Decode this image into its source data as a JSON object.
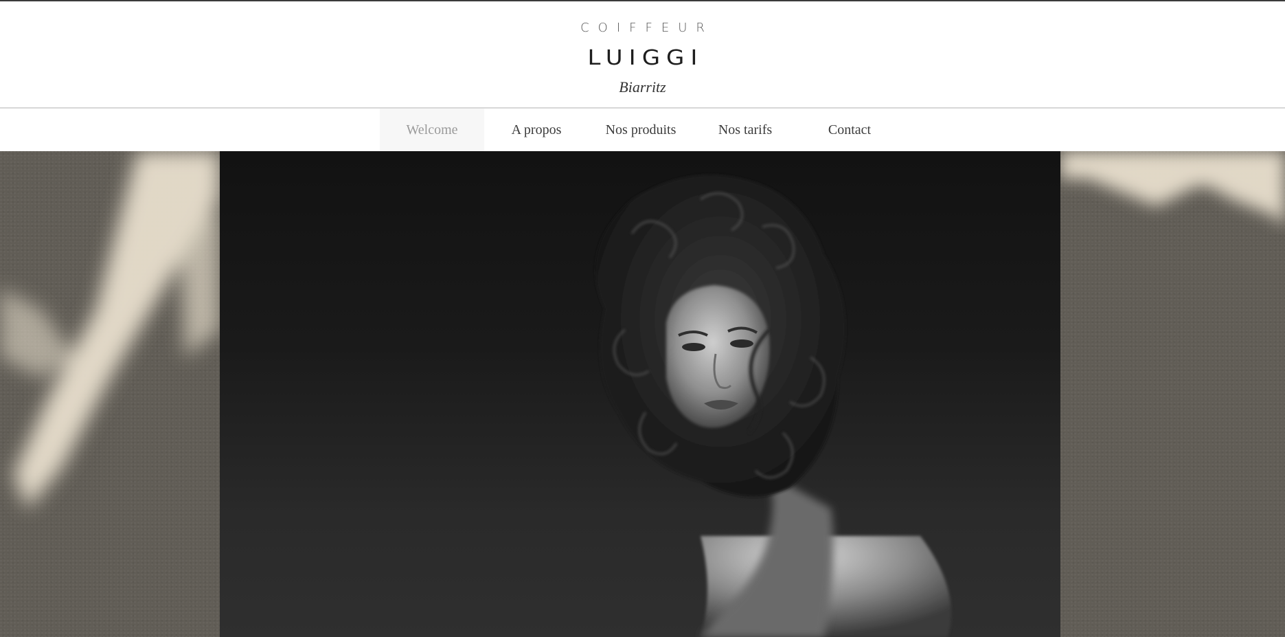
{
  "brand": {
    "kicker": "COIFFEUR",
    "name": "LUIGGI",
    "city": "Biarritz"
  },
  "nav": {
    "items": [
      {
        "label": "Welcome",
        "active": true
      },
      {
        "label": "A propos",
        "active": false
      },
      {
        "label": "Nos produits",
        "active": false
      },
      {
        "label": "Nos tarifs",
        "active": false
      },
      {
        "label": "Contact",
        "active": false
      }
    ]
  },
  "colors": {
    "header_bg": "#ffffff",
    "nav_active_bg": "#f7f7f7",
    "nav_active_text": "#9a9a9a",
    "nav_text": "#3c3c3c",
    "wall": "#615d56",
    "wall_light": "#e8dfcd",
    "photo_bg": "#1a1a1a"
  }
}
